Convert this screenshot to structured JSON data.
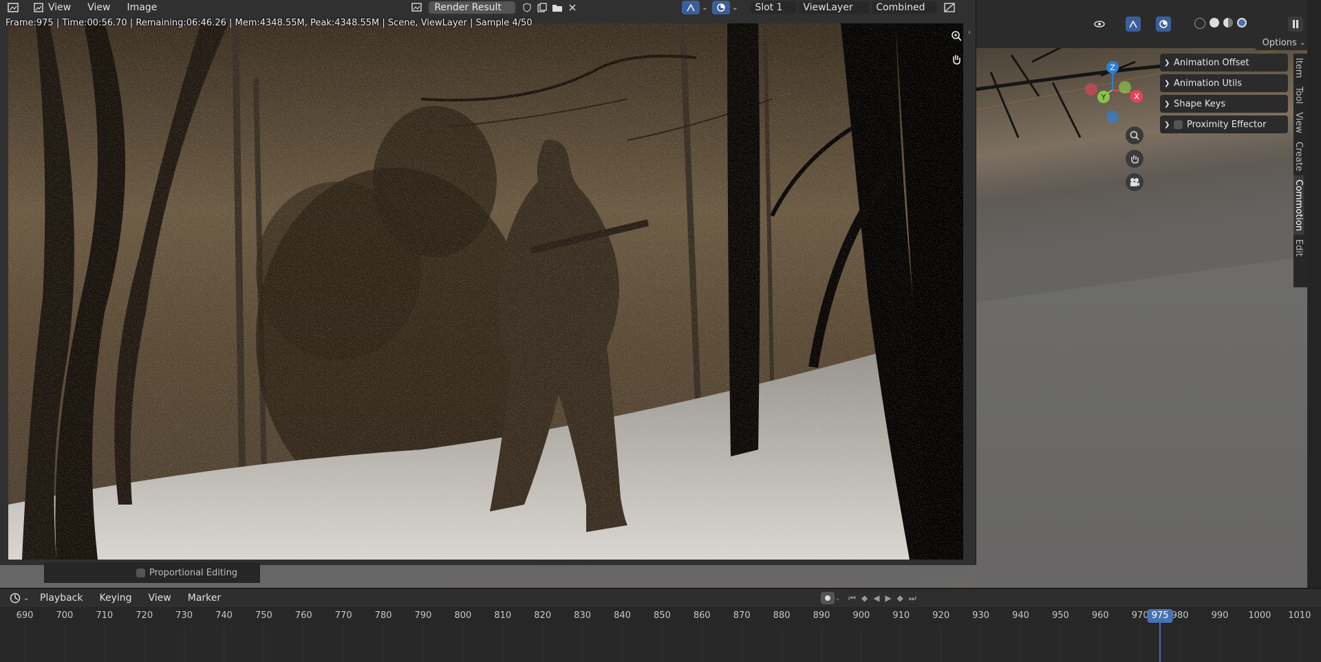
{
  "image_editor": {
    "menus": [
      "View",
      "View",
      "Image"
    ],
    "image_name": "Render Result",
    "slot": "Slot 1",
    "view_layer": "ViewLayer",
    "pass": "Combined",
    "stats": "Frame:975 | Time:00:56.70 | Remaining:06:46.26 | Mem:4348.55M, Peak:4348.55M | Scene, ViewLayer | Sample 4/50"
  },
  "viewport": {
    "options_label": "Options",
    "gizmo_axes": [
      "Z",
      "Y",
      "X"
    ],
    "npanel_items": [
      "Animation Offset",
      "Animation Utils",
      "Shape Keys",
      "Proximity Effector"
    ],
    "tabs": [
      "Item",
      "Tool",
      "View",
      "Create",
      "Commotion",
      "Edit"
    ],
    "proportional_editing": "Proportional Editing"
  },
  "timeline": {
    "menus": [
      "Playback",
      "Keying",
      "View",
      "Marker"
    ],
    "ticks": [
      690,
      700,
      710,
      720,
      730,
      740,
      750,
      760,
      770,
      780,
      790,
      800,
      810,
      820,
      830,
      840,
      850,
      860,
      870,
      880,
      890,
      900,
      910,
      920,
      930,
      940,
      950,
      960,
      970,
      980,
      990,
      1000,
      1010
    ],
    "current_frame": "975"
  },
  "colors": {
    "accent": "#4772b3",
    "axis_x": "#e8435a",
    "axis_y": "#8bc34a",
    "axis_z": "#2f7fd6"
  }
}
